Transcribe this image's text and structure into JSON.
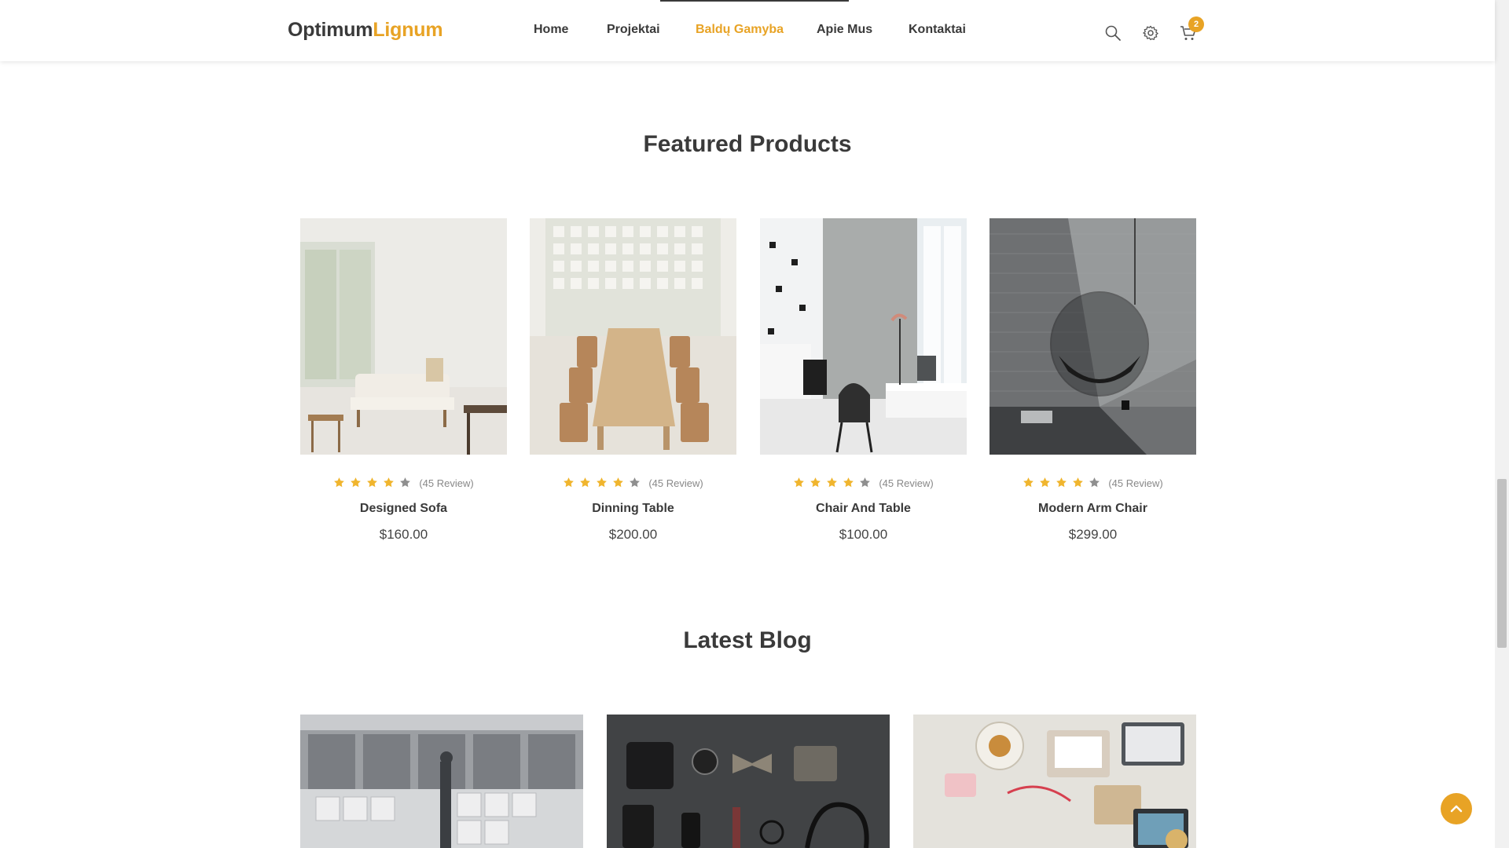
{
  "brand": {
    "part1": "Optimum",
    "part2": "Lignum",
    "accent_color": "#e8a325"
  },
  "nav": {
    "items": [
      {
        "label": "Home",
        "active": false
      },
      {
        "label": "Projektai",
        "active": false
      },
      {
        "label": "Baldų Gamyba",
        "active": true
      },
      {
        "label": "Apie Mus",
        "active": false
      },
      {
        "label": "Kontaktai",
        "active": false
      }
    ]
  },
  "header_icons": {
    "search": "search-icon",
    "settings": "gear-icon",
    "cart": "cart-icon",
    "cart_count": "2"
  },
  "featured": {
    "title": "Featured Products",
    "products": [
      {
        "name": "Designed Sofa",
        "price": "$160.00",
        "reviews": "(45 Review)",
        "rating": 4
      },
      {
        "name": "Dinning Table",
        "price": "$200.00",
        "reviews": "(45 Review)",
        "rating": 4
      },
      {
        "name": "Chair And Table",
        "price": "$100.00",
        "reviews": "(45 Review)",
        "rating": 4
      },
      {
        "name": "Modern Arm Chair",
        "price": "$299.00",
        "reviews": "(45 Review)",
        "rating": 4
      }
    ]
  },
  "blog": {
    "title": "Latest Blog"
  },
  "back_to_top": "chevron-up-icon"
}
